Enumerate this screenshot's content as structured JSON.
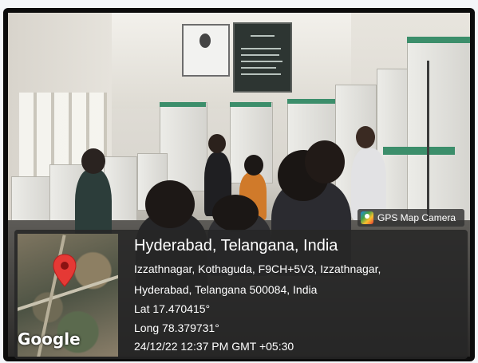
{
  "overlay": {
    "badge": "GPS Map Camera",
    "title": "Hyderabad, Telangana, India",
    "address_line1": "Izzathnagar, Kothaguda, F9CH+5V3, Izzathnagar,",
    "address_line2": "Hyderabad, Telangana 500084, India",
    "lat": "Lat 17.470415°",
    "long": "Long 78.379731°",
    "datetime": "24/12/22 12:37 PM GMT +05:30",
    "map_brand": "Google"
  },
  "icons": [
    "gps-map-camera-icon",
    "map-pin-icon"
  ],
  "colors": {
    "panel_accent": "#3c8e6b",
    "overlay_bg": "#262626",
    "pin": "#e53935"
  }
}
